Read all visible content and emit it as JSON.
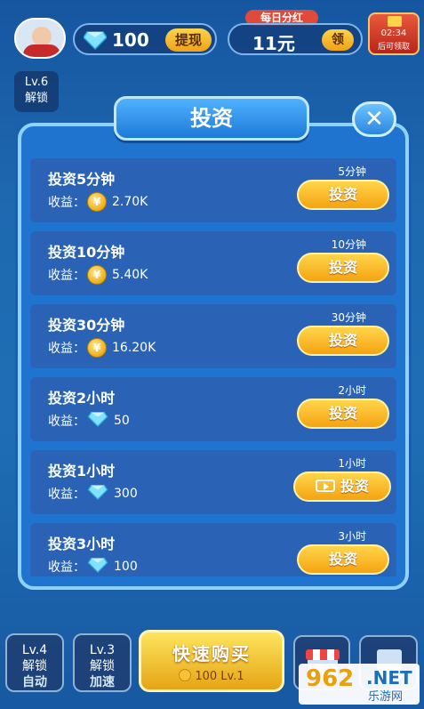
{
  "header": {
    "gem_count": "100",
    "withdraw_label": "提现",
    "daily_bonus_label": "每日分红",
    "money_amount": "11元",
    "claim_label": "领",
    "timer": "02:34",
    "timer_sub": "后可领取"
  },
  "side": {
    "top_unlock_level": "Lv.6",
    "top_unlock_label": "解锁"
  },
  "modal": {
    "title": "投资",
    "reward_prefix": "收益：",
    "rows": [
      {
        "title": "投资5分钟",
        "duration": "5分钟",
        "reward_type": "coin",
        "reward": "2.70K",
        "button": "投资",
        "video": false
      },
      {
        "title": "投资10分钟",
        "duration": "10分钟",
        "reward_type": "coin",
        "reward": "5.40K",
        "button": "投资",
        "video": false
      },
      {
        "title": "投资30分钟",
        "duration": "30分钟",
        "reward_type": "coin",
        "reward": "16.20K",
        "button": "投资",
        "video": false
      },
      {
        "title": "投资2小时",
        "duration": "2小时",
        "reward_type": "gem",
        "reward": "50",
        "button": "投资",
        "video": false
      },
      {
        "title": "投资1小时",
        "duration": "1小时",
        "reward_type": "gem",
        "reward": "300",
        "button": "投资",
        "video": true
      },
      {
        "title": "投资3小时",
        "duration": "3小时",
        "reward_type": "gem",
        "reward": "100",
        "button": "投资",
        "video": false
      }
    ]
  },
  "bottom": {
    "auto_level": "Lv.4",
    "auto_unlock": "解锁",
    "auto_label": "自动",
    "speed_level": "Lv.3",
    "speed_unlock": "解锁",
    "speed_label": "加速",
    "buy_label": "快速购买",
    "buy_cost": "100 Lv.1"
  },
  "watermark": {
    "number": "962",
    "net": ".NET",
    "text": "乐游网"
  },
  "colors": {
    "accent_gold": "#f5a312",
    "panel_blue": "#1f74d0",
    "row_blue": "#2a63b5"
  }
}
